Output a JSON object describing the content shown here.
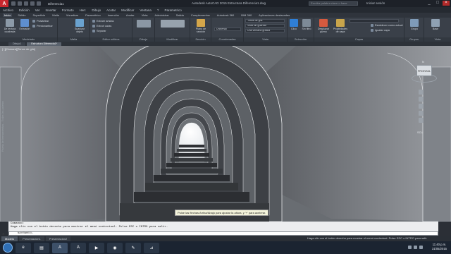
{
  "app": {
    "title": "Autodesk AutoCAD 2015   Estructura Diferencia1.dwg",
    "logo": "A",
    "doc_tab": "Diferencia1",
    "search_placeholder": "Escriba palabra clave o frase",
    "signin": "Iniciar sesión"
  },
  "menu": [
    "Archivo",
    "Edición",
    "Ver",
    "Insertar",
    "Formato",
    "Herr.",
    "Dibujo",
    "Acotar",
    "Modificar",
    "Ventana",
    "?",
    "Parametrico"
  ],
  "ribbon_tabs": [
    {
      "label": "Inicio",
      "active": true
    },
    {
      "label": "Sólido"
    },
    {
      "label": "Superficie"
    },
    {
      "label": "Malla"
    },
    {
      "label": "Visualizar"
    },
    {
      "label": "Paramétrico"
    },
    {
      "label": "Inserción"
    },
    {
      "label": "Anotar"
    },
    {
      "label": "Vista"
    },
    {
      "label": "Administrar"
    },
    {
      "label": "Salida"
    },
    {
      "label": "Complementos"
    },
    {
      "label": "Autodesk 360"
    },
    {
      "label": "BIM 360"
    },
    {
      "label": "Aplicaciones destacadas"
    }
  ],
  "ribbon": {
    "modelado": {
      "title": "Modelado",
      "btn1": "De textura cuadrada",
      "btn2": "Extrusión",
      "s1": "Pulsártirar",
      "s2": "Presionartirar"
    },
    "malla": {
      "title": "Malla",
      "btn": "Suavizar objeto"
    },
    "editor": {
      "title": "Editor sólidos",
      "s1": "Extraer aristas",
      "s2": "Extruir caras",
      "s3": "Separar"
    },
    "dibujo": {
      "title": "Dibujo"
    },
    "modificar": {
      "title": "Modificar"
    },
    "seccion": {
      "title": "Sección",
      "btn": "Plano de sección"
    },
    "coordenadas": {
      "title": "Coordenadas",
      "combo": "Universal"
    },
    "vista": {
      "title": "Vista",
      "combo1": "Tonos de gris",
      "combo2": "Vista sin guardar",
      "combo3": "Una ventana gráfica"
    },
    "seleccion": {
      "title": "Selección",
      "btn1": "Cilco",
      "btn2": "Sin filtro"
    },
    "capas": {
      "title": "Capas",
      "btn1": "Desplazar gizmo",
      "btn2": "Propiedades de capa",
      "s1": "Establecer como actual",
      "s2": "Igualar capa"
    },
    "grupos": {
      "title": "Grupos",
      "btn": "Grupo"
    },
    "vista2": {
      "title": "Vista",
      "btn": "Base"
    }
  },
  "file_tabs": [
    {
      "label": "Dibujo1"
    },
    {
      "label": "Estructura Diferencia1*",
      "active": true
    }
  ],
  "viewport": {
    "label": "[−][Cámara][Tonos de gris]",
    "viewcube_face": "FRONTAL",
    "viewcube_north": "N",
    "wcs": "SCU",
    "side_text": "Paleta de herramientas - Todas las paletas",
    "hint": "Pulse las flechas Arriba/Abajo para ajustar la altura, y '+' para acelerar."
  },
  "command": {
    "history_title": "Comando:",
    "history_line": "Haga clic con el botón derecho para mostrar el menú contextual. Pulse ESC o INTRO para salir.",
    "current": "NAVSWHEEL"
  },
  "layout_tabs": [
    {
      "label": "Modelo",
      "active": true
    },
    {
      "label": "Presentación1"
    },
    {
      "label": "Presentación2"
    }
  ],
  "status_message": "Haga clic con el botón derecho para mostrar el menú contextual. Pulse ESC o INTRO para salir.",
  "taskbar": {
    "apps": [
      "ie-icon",
      "explorer-icon",
      "autocad-icon",
      "autocad-icon-2",
      "media-icon",
      "chrome-icon",
      "paint-icon",
      "acrobat-icon"
    ],
    "time": "11:40 p.m.",
    "date": "31/05/2015"
  }
}
